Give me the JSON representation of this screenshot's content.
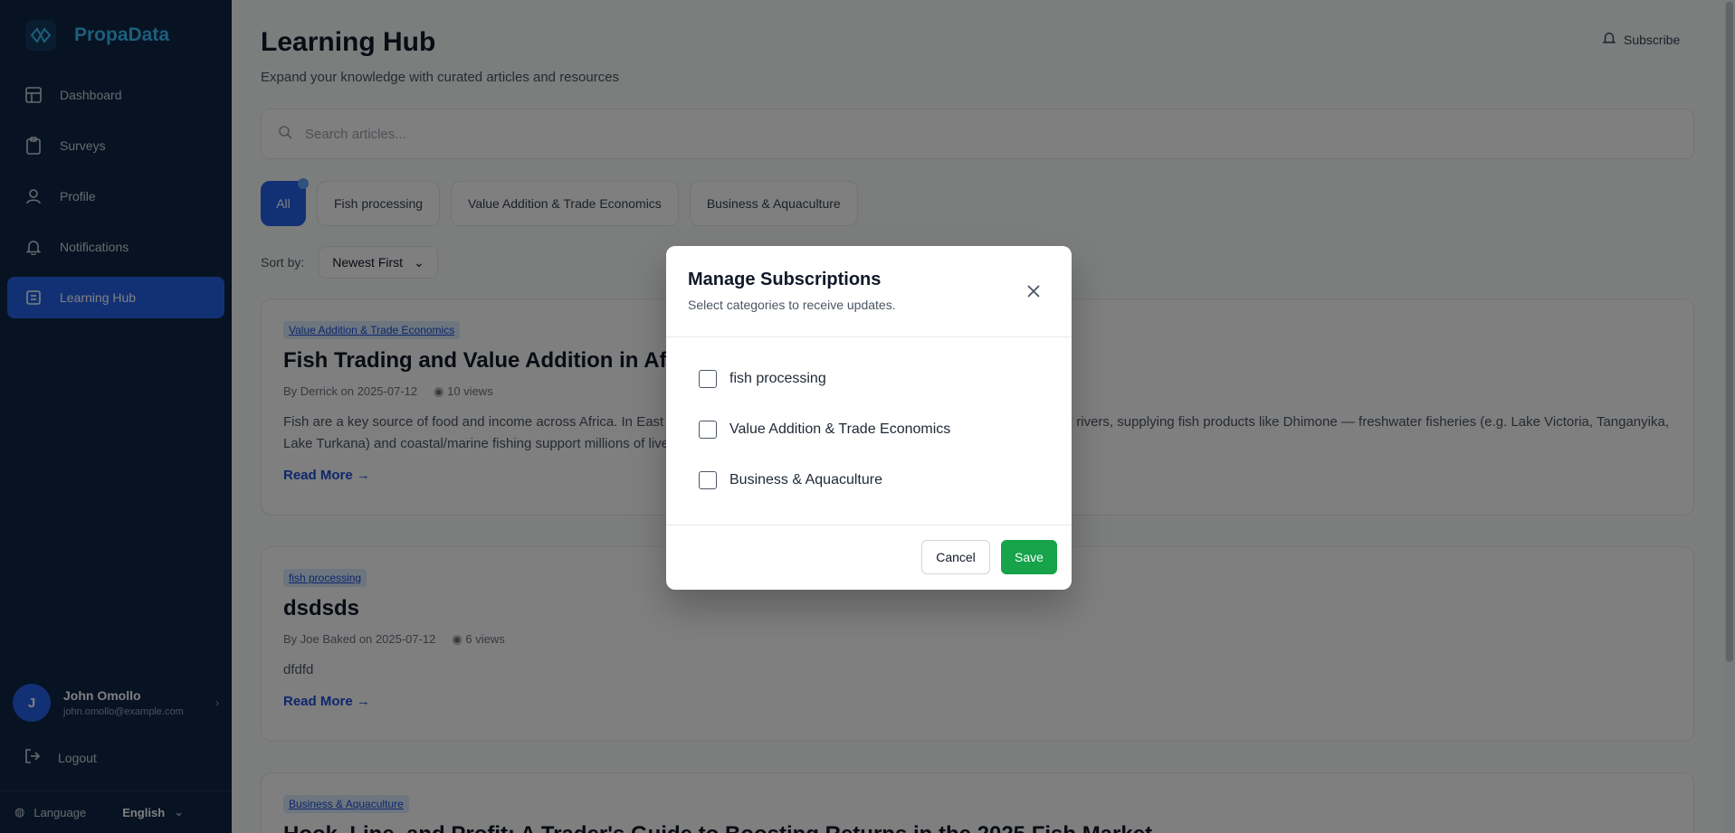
{
  "brand": {
    "name": "PropaData"
  },
  "sidebar": {
    "items": [
      {
        "label": "Dashboard",
        "icon": "grid-icon"
      },
      {
        "label": "Surveys",
        "icon": "clipboard-icon"
      },
      {
        "label": "Profile",
        "icon": "user-icon"
      },
      {
        "label": "Notifications",
        "icon": "bell-icon"
      },
      {
        "label": "Learning Hub",
        "icon": "book-icon",
        "active": true
      }
    ],
    "user": {
      "initial": "J",
      "name": "John Omollo",
      "email": "john.omollo@example.com"
    },
    "logout_label": "Logout",
    "language_label": "Language",
    "language_value": "English"
  },
  "header": {
    "title": "Learning Hub",
    "subtitle": "Expand your knowledge with curated articles and resources",
    "subscribe_label": "Subscribe"
  },
  "search": {
    "placeholder": "Search articles..."
  },
  "filters": {
    "all_label": "All",
    "items": [
      "Fish processing",
      "Value Addition & Trade Economics",
      "Business & Aquaculture"
    ]
  },
  "sort": {
    "label": "Sort by:",
    "value": "Newest First"
  },
  "articles": [
    {
      "tag": "Value Addition & Trade Economics",
      "title": "Fish Trading and Value Addition in Africa",
      "meta": "By Derrick on 2025-07-12",
      "views": "10 views",
      "excerpt": "Fish are a key source of food and income across Africa. In East Africa, inland fisheries are critical for communities around lakes and rivers, supplying fish products like Dhimone — freshwater fisheries (e.g. Lake Victoria, Tanganyika, Lake Turkana) and coastal/marine fishing support millions of livelihoods, yet",
      "more": "Read More →"
    },
    {
      "tag": "fish processing",
      "title": "dsdsds",
      "meta": "By Joe Baked on 2025-07-12",
      "views": "6 views",
      "excerpt": "dfdfd",
      "more": "Read More →"
    },
    {
      "tag": "Business & Aquaculture",
      "title": "Hook, Line, and Profit: A Trader's Guide to Boosting Returns in the 2025 Fish Market"
    }
  ],
  "modal": {
    "title": "Manage Subscriptions",
    "subtitle": "Select categories to receive updates.",
    "options": [
      {
        "label": "fish processing",
        "checked": false
      },
      {
        "label": "Value Addition & Trade Economics",
        "checked": false
      },
      {
        "label": "Business & Aquaculture",
        "checked": false
      }
    ],
    "cancel_label": "Cancel",
    "save_label": "Save"
  },
  "colors": {
    "sidebar_bg": "#0f2744",
    "accent": "#2563eb",
    "brand": "#38bdf8",
    "save": "#16a34a"
  }
}
